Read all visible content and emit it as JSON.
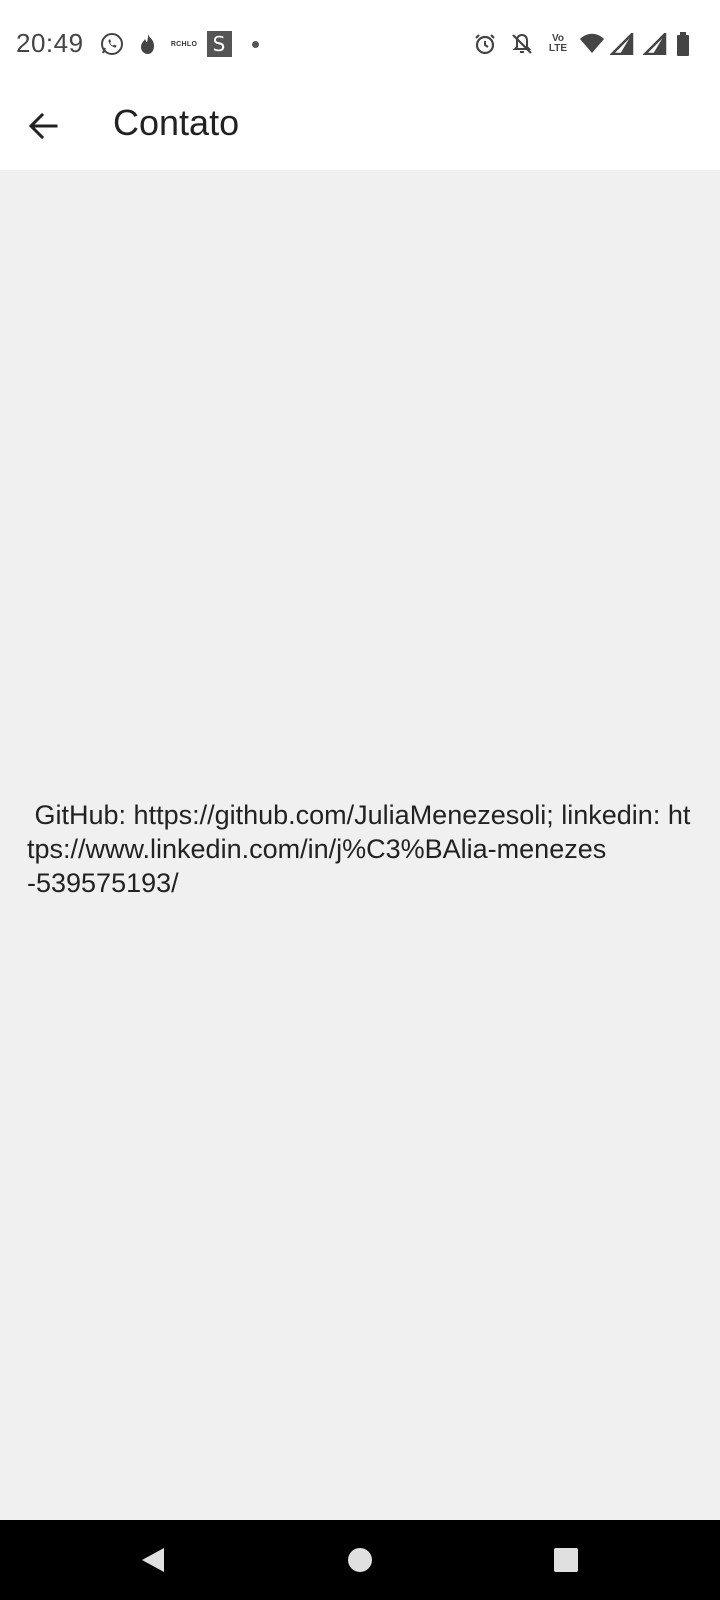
{
  "status_bar": {
    "time": "20:49",
    "notification_icons": [
      "whatsapp-icon",
      "tinder-icon",
      "rchlo-icon",
      "s-app-icon",
      "more-dot-icon"
    ],
    "rchlo_label": "RCHLO",
    "s_label": "S",
    "volte_top": "Vo",
    "volte_bottom": "LTE",
    "system_icons": [
      "alarm-icon",
      "notifications-off-icon",
      "volte-icon",
      "wifi-icon",
      "signal-icon",
      "signal-icon",
      "battery-icon"
    ]
  },
  "app_bar": {
    "title": "Contato",
    "back_icon": "arrow-back-icon"
  },
  "content": {
    "text": " GitHub: https://github.com/JuliaMenezesoli; linkedin: https://www.linkedin.com/in/j%C3%BAlia-menezes\n-539575193/"
  },
  "nav_bar": {
    "buttons": [
      "back-triangle-icon",
      "home-circle-icon",
      "recents-square-icon"
    ]
  },
  "colors": {
    "status_bar_bg": "#ffffff",
    "app_bar_bg": "#ffffff",
    "content_bg": "#f0f0f0",
    "nav_bar_bg": "#000000",
    "nav_icon": "#e0e0e0"
  }
}
